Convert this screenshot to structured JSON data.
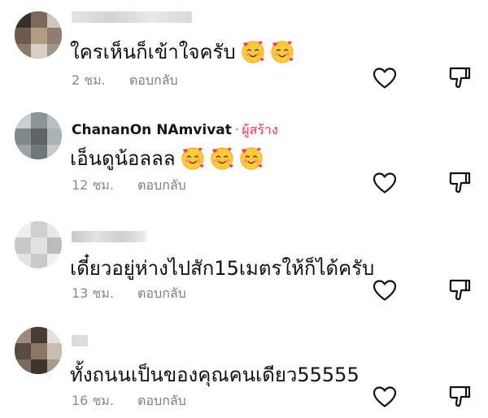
{
  "comments": [
    {
      "author": "",
      "text": "ใครเห็นก็เข้าใจครับ",
      "emoji_count": 2,
      "time": "2 ชม.",
      "reply_label": "ตอบกลับ"
    },
    {
      "author": "ChananOn NAmvivat",
      "author_dot": "·",
      "creator_badge": "ผู้สร้าง",
      "text": "เอ็นดูน้อลลล",
      "emoji_count": 3,
      "time": "12 ชม.",
      "reply_label": "ตอบกลับ"
    },
    {
      "author": "",
      "text": "เดี๋ยวอยู่ห่างไปสัก15เมตรให้ก็ได้ครับ",
      "emoji_count": 0,
      "time": "13 ชม.",
      "reply_label": "ตอบกลับ"
    },
    {
      "author": "",
      "text": "ทั้งถนนเป็นของคุณคนเดียว55555",
      "emoji_count": 0,
      "time": "16 ชม.",
      "reply_label": "ตอบกลับ"
    }
  ],
  "icons": {
    "like": "heart-outline-icon",
    "dislike": "thumbs-down-outline-icon",
    "emoji": "smiling-face-with-hearts-emoji"
  },
  "colors": {
    "creator_badge": "#fe2c55",
    "meta_text": "#8a8a8a",
    "icon_stroke": "#111111"
  }
}
